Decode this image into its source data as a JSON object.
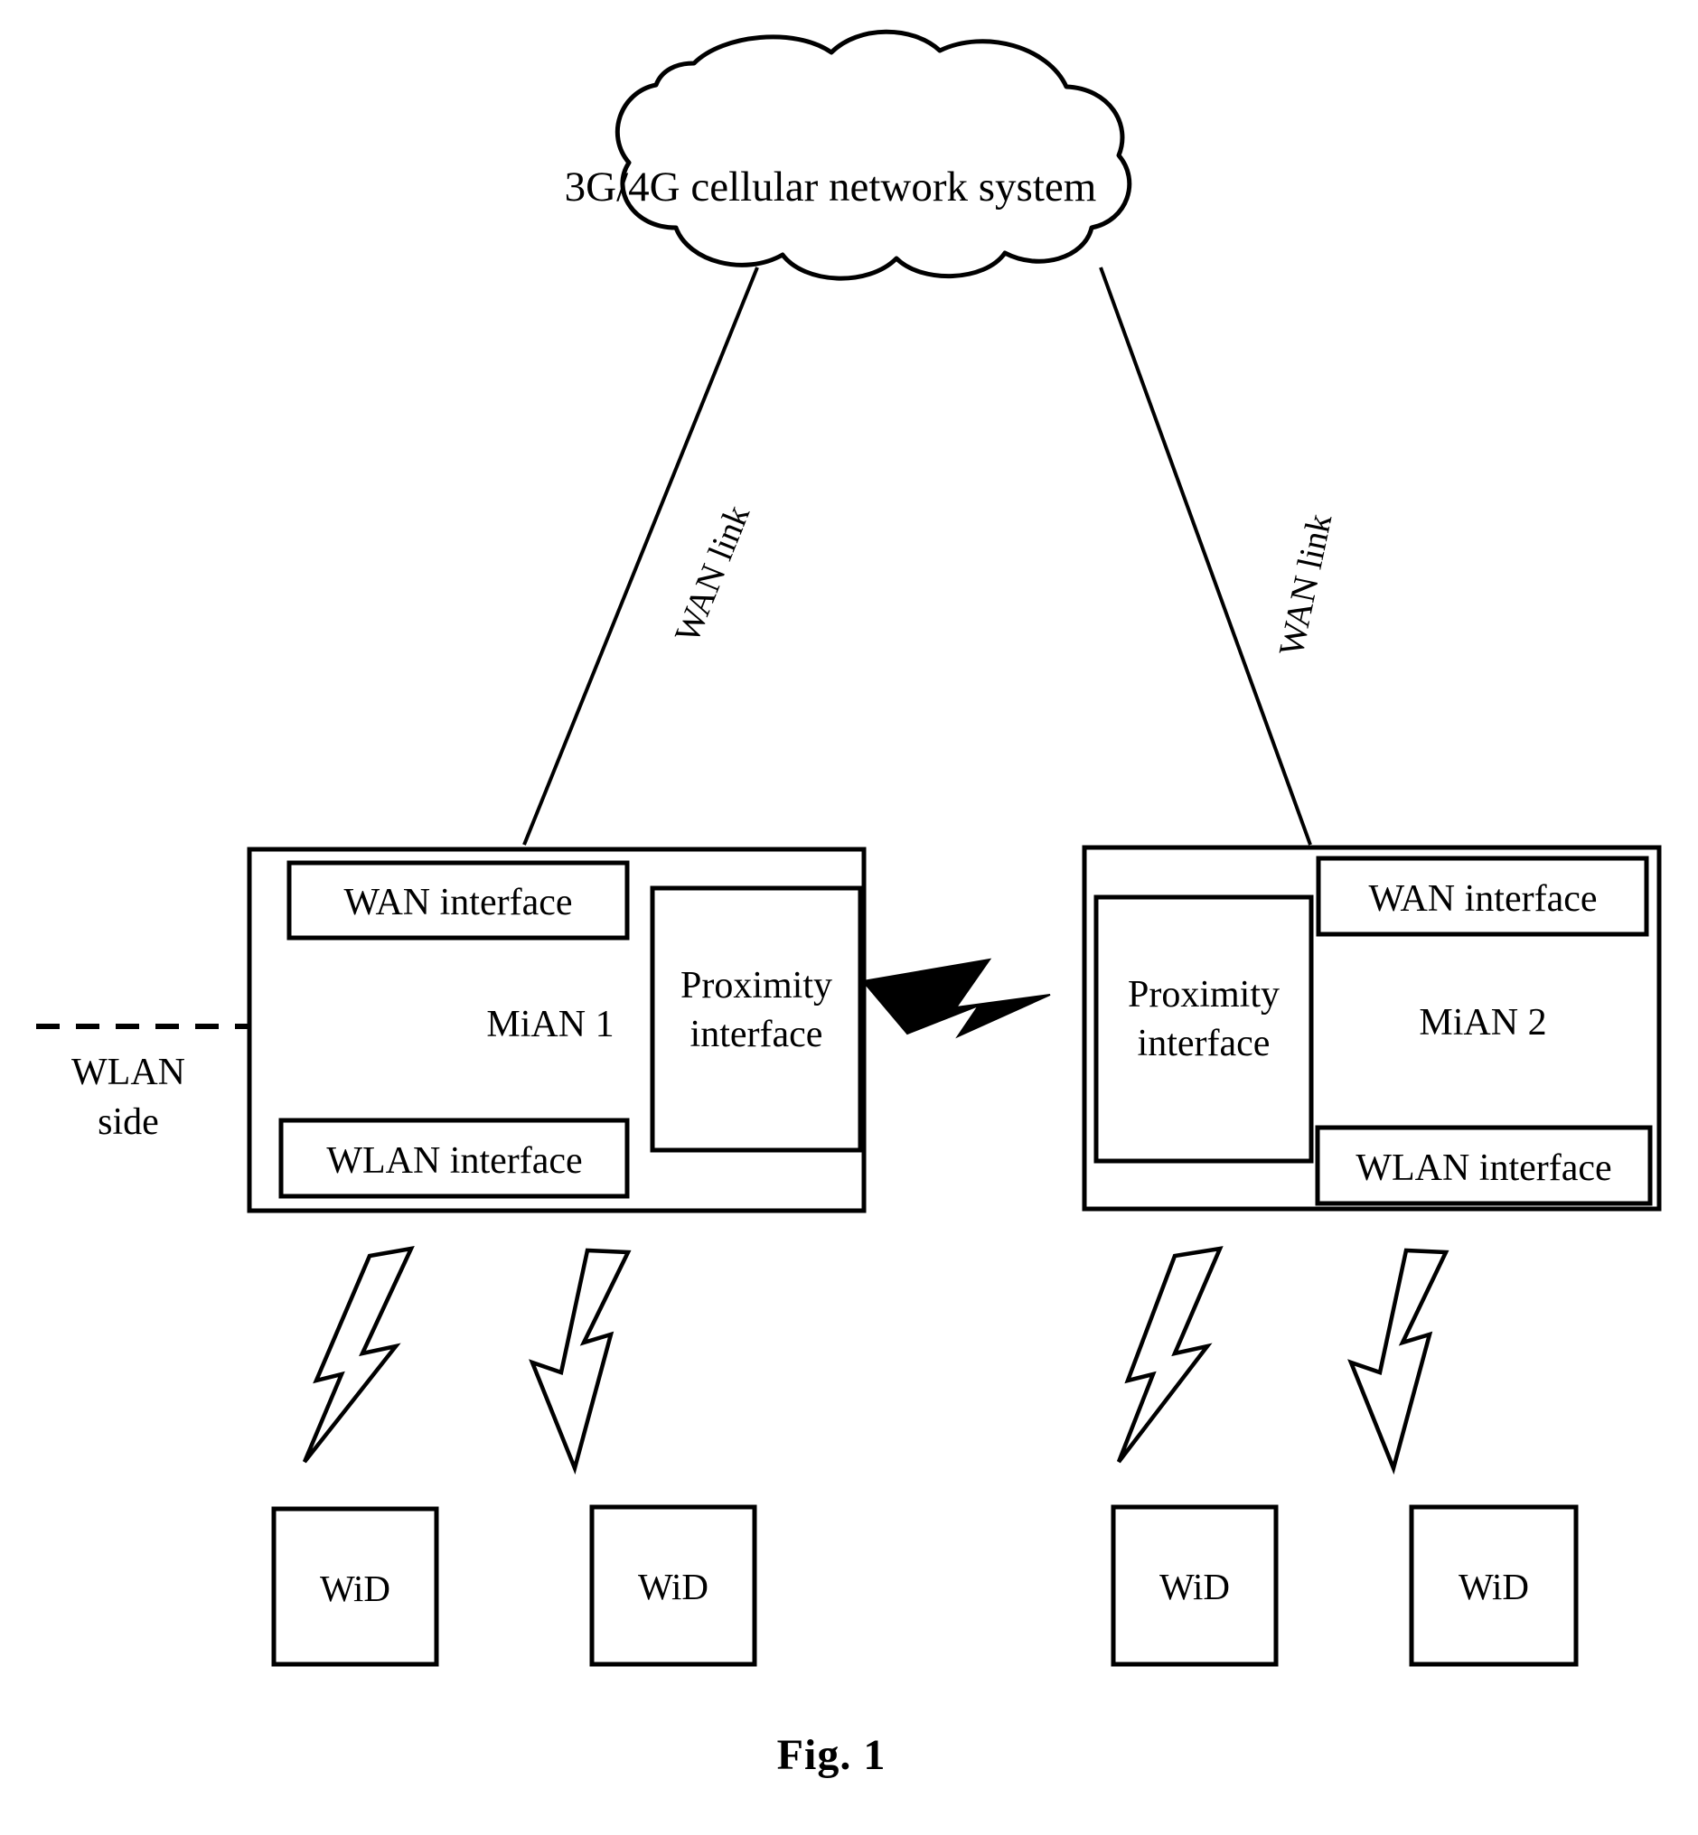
{
  "figure": {
    "caption": "Fig. 1",
    "cloud": {
      "label": "3G/4G cellular network system"
    },
    "links": [
      {
        "name": "wan-link-left",
        "label": "WAN link"
      },
      {
        "name": "wan-link-right",
        "label": "WAN link"
      }
    ],
    "wlan_side": {
      "line1": "WLAN",
      "line2": "side"
    },
    "nodes": [
      {
        "id": "mian1",
        "label": "MiAN 1",
        "wan_interface": "WAN interface",
        "wlan_interface": "WLAN interface",
        "proximity_interface_line1": "Proximity",
        "proximity_interface_line2": "interface"
      },
      {
        "id": "mian2",
        "label": "MiAN 2",
        "wan_interface": "WAN interface",
        "wlan_interface": "WLAN interface",
        "proximity_interface_line1": "Proximity",
        "proximity_interface_line2": "interface"
      }
    ],
    "devices": [
      {
        "id": "wid-1",
        "label": "WiD"
      },
      {
        "id": "wid-2",
        "label": "WiD"
      },
      {
        "id": "wid-3",
        "label": "WiD"
      },
      {
        "id": "wid-4",
        "label": "WiD"
      }
    ],
    "colors": {
      "stroke": "#000000",
      "background": "#ffffff"
    }
  }
}
